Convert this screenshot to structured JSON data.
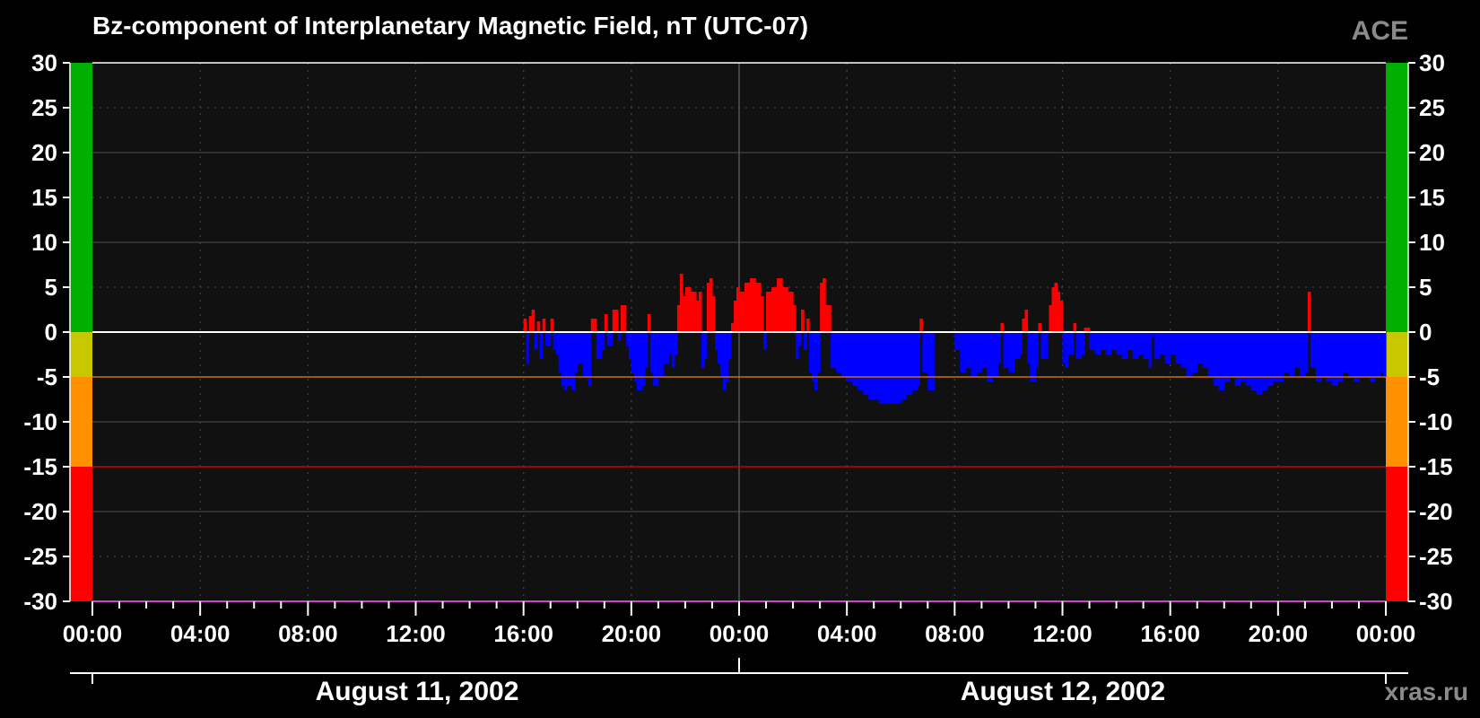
{
  "header": {
    "title": "Bz-component of Interplanetary Magnetic Field, nT (UTC-07)",
    "source": "ACE"
  },
  "footer": {
    "credit": "xras.ru",
    "dates": [
      "August 11, 2002",
      "August 12, 2002"
    ]
  },
  "colors": {
    "positive": "#ff0000",
    "negative": "#0000ff",
    "plot_bg": "#111111",
    "band_green": "#00b000",
    "band_yellow": "#c8c800",
    "band_orange": "#ff9000",
    "band_red": "#ff0000",
    "line_minus5": "#c87000",
    "line_minus15": "#c80000"
  },
  "chart_data": {
    "type": "bar",
    "title": "Bz-component of Interplanetary Magnetic Field, nT (UTC-07)",
    "xlabel": "",
    "ylabel": "",
    "xlim": [
      "2002-08-11 00:00",
      "2002-08-13 00:00"
    ],
    "ylim": [
      -30,
      30
    ],
    "yticks": [
      30,
      25,
      20,
      15,
      10,
      5,
      0,
      -5,
      -10,
      -15,
      -20,
      -25,
      -30
    ],
    "xtick_labels": [
      "00:00",
      "04:00",
      "08:00",
      "12:00",
      "16:00",
      "20:00",
      "00:00",
      "04:00",
      "08:00",
      "12:00",
      "16:00",
      "20:00",
      "00:00"
    ],
    "reference_lines": [
      0,
      -5,
      -15
    ],
    "color_bands": [
      {
        "from": 0,
        "to": 30,
        "color": "green"
      },
      {
        "from": -5,
        "to": 0,
        "color": "yellow"
      },
      {
        "from": -15,
        "to": -5,
        "color": "orange"
      },
      {
        "from": -30,
        "to": -15,
        "color": "red"
      }
    ],
    "grid": true,
    "legend": "none",
    "x_units": "hours since 2002-08-11 00:00 (UTC-07)",
    "series": [
      {
        "values": [
          [
            16.0,
            1.5
          ],
          [
            16.1,
            -3.5
          ],
          [
            16.2,
            1.8
          ],
          [
            16.3,
            2.5
          ],
          [
            16.4,
            -2.0
          ],
          [
            16.5,
            1.2
          ],
          [
            16.6,
            -3.0
          ],
          [
            16.7,
            1.5
          ],
          [
            16.8,
            -1.5
          ],
          [
            17.0,
            1.5
          ],
          [
            17.1,
            -2.0
          ],
          [
            17.2,
            -2.5
          ],
          [
            17.3,
            -4.5
          ],
          [
            17.4,
            -6.0
          ],
          [
            17.5,
            -6.5
          ],
          [
            17.6,
            -6.0
          ],
          [
            17.8,
            -6.5
          ],
          [
            17.9,
            -4.5
          ],
          [
            18.0,
            -3.5
          ],
          [
            18.2,
            -5.0
          ],
          [
            18.4,
            -6.0
          ],
          [
            18.5,
            1.5
          ],
          [
            18.7,
            -3.0
          ],
          [
            18.9,
            -2.0
          ],
          [
            19.0,
            2.0
          ],
          [
            19.1,
            -1.5
          ],
          [
            19.3,
            2.5
          ],
          [
            19.5,
            -1.0
          ],
          [
            19.6,
            3.0
          ],
          [
            19.8,
            -1.5
          ],
          [
            19.9,
            -3.0
          ],
          [
            20.0,
            -4.5
          ],
          [
            20.1,
            -5.5
          ],
          [
            20.2,
            -6.5
          ],
          [
            20.4,
            -6.0
          ],
          [
            20.5,
            -4.0
          ],
          [
            20.6,
            2.0
          ],
          [
            20.7,
            -4.5
          ],
          [
            20.8,
            -6.0
          ],
          [
            21.0,
            -5.0
          ],
          [
            21.2,
            -3.5
          ],
          [
            21.4,
            -2.5
          ],
          [
            21.5,
            -4.0
          ],
          [
            21.6,
            -2.5
          ],
          [
            21.7,
            3.0
          ],
          [
            21.8,
            6.5
          ],
          [
            21.9,
            4.0
          ],
          [
            22.0,
            5.0
          ],
          [
            22.2,
            4.5
          ],
          [
            22.4,
            3.5
          ],
          [
            22.5,
            4.5
          ],
          [
            22.6,
            -4.0
          ],
          [
            22.7,
            -3.0
          ],
          [
            22.8,
            5.5
          ],
          [
            22.9,
            6.0
          ],
          [
            23.0,
            4.0
          ],
          [
            23.1,
            -2.0
          ],
          [
            23.2,
            -3.5
          ],
          [
            23.3,
            -5.0
          ],
          [
            23.4,
            -6.5
          ],
          [
            23.5,
            -5.5
          ],
          [
            23.6,
            -3.0
          ],
          [
            23.7,
            1.0
          ],
          [
            23.8,
            3.5
          ],
          [
            23.9,
            5.0
          ],
          [
            24.0,
            4.5
          ],
          [
            24.2,
            5.5
          ],
          [
            24.4,
            6.0
          ],
          [
            24.6,
            5.5
          ],
          [
            24.8,
            4.0
          ],
          [
            24.9,
            -2.0
          ],
          [
            25.0,
            4.5
          ],
          [
            25.2,
            5.0
          ],
          [
            25.4,
            6.0
          ],
          [
            25.6,
            5.0
          ],
          [
            25.8,
            4.5
          ],
          [
            26.0,
            3.0
          ],
          [
            26.1,
            -3.0
          ],
          [
            26.2,
            -1.5
          ],
          [
            26.3,
            2.5
          ],
          [
            26.4,
            -2.0
          ],
          [
            26.5,
            1.5
          ],
          [
            26.6,
            -4.5
          ],
          [
            26.7,
            -5.5
          ],
          [
            26.8,
            -6.5
          ],
          [
            26.9,
            -4.5
          ],
          [
            27.0,
            5.5
          ],
          [
            27.1,
            6.0
          ],
          [
            27.2,
            3.0
          ],
          [
            27.4,
            -4.0
          ],
          [
            27.6,
            -4.5
          ],
          [
            27.8,
            -5.0
          ],
          [
            28.0,
            -5.5
          ],
          [
            28.2,
            -6.0
          ],
          [
            28.4,
            -6.5
          ],
          [
            28.6,
            -7.0
          ],
          [
            28.8,
            -7.5
          ],
          [
            29.0,
            -7.5
          ],
          [
            29.2,
            -8.0
          ],
          [
            29.4,
            -8.0
          ],
          [
            29.6,
            -8.0
          ],
          [
            29.8,
            -8.0
          ],
          [
            30.0,
            -7.5
          ],
          [
            30.2,
            -7.0
          ],
          [
            30.4,
            -6.5
          ],
          [
            30.6,
            -6.0
          ],
          [
            30.7,
            1.5
          ],
          [
            30.8,
            -4.5
          ],
          [
            31.0,
            -6.5
          ],
          [
            32.0,
            -2.0
          ],
          [
            32.2,
            -4.5
          ],
          [
            32.4,
            -4.0
          ],
          [
            32.6,
            -5.0
          ],
          [
            32.8,
            -4.5
          ],
          [
            33.0,
            -4.0
          ],
          [
            33.2,
            -5.5
          ],
          [
            33.4,
            -5.0
          ],
          [
            33.6,
            -3.5
          ],
          [
            33.7,
            1.0
          ],
          [
            33.8,
            -4.0
          ],
          [
            34.0,
            -4.5
          ],
          [
            34.2,
            -3.0
          ],
          [
            34.4,
            -2.5
          ],
          [
            34.5,
            1.5
          ],
          [
            34.6,
            2.5
          ],
          [
            34.7,
            -3.5
          ],
          [
            34.8,
            -5.5
          ],
          [
            35.0,
            -4.0
          ],
          [
            35.1,
            1.0
          ],
          [
            35.2,
            -3.0
          ],
          [
            35.5,
            3.0
          ],
          [
            35.6,
            5.0
          ],
          [
            35.7,
            5.5
          ],
          [
            35.8,
            4.5
          ],
          [
            35.9,
            3.5
          ],
          [
            36.0,
            -3.5
          ],
          [
            36.1,
            -4.0
          ],
          [
            36.2,
            -2.5
          ],
          [
            36.4,
            1.0
          ],
          [
            36.5,
            -3.0
          ],
          [
            36.7,
            -2.5
          ],
          [
            36.8,
            0.5
          ],
          [
            37.0,
            -2.0
          ],
          [
            37.2,
            -2.5
          ],
          [
            37.4,
            -2.0
          ],
          [
            37.6,
            -2.5
          ],
          [
            37.8,
            -2.0
          ],
          [
            38.0,
            -2.5
          ],
          [
            38.2,
            -3.0
          ],
          [
            38.4,
            -2.0
          ],
          [
            38.6,
            -3.0
          ],
          [
            38.8,
            -2.5
          ],
          [
            39.0,
            -3.0
          ],
          [
            39.2,
            -4.0
          ],
          [
            39.3,
            -0.5
          ],
          [
            39.4,
            -3.0
          ],
          [
            39.6,
            -2.5
          ],
          [
            39.8,
            -3.5
          ],
          [
            40.0,
            -2.5
          ],
          [
            40.2,
            -3.5
          ],
          [
            40.4,
            -4.0
          ],
          [
            40.6,
            -5.0
          ],
          [
            40.8,
            -4.5
          ],
          [
            41.0,
            -3.5
          ],
          [
            41.2,
            -4.0
          ],
          [
            41.4,
            -5.0
          ],
          [
            41.6,
            -6.0
          ],
          [
            41.8,
            -6.5
          ],
          [
            42.0,
            -5.5
          ],
          [
            42.2,
            -5.0
          ],
          [
            42.4,
            -6.0
          ],
          [
            42.6,
            -5.5
          ],
          [
            42.8,
            -6.0
          ],
          [
            43.0,
            -6.5
          ],
          [
            43.2,
            -7.0
          ],
          [
            43.4,
            -6.5
          ],
          [
            43.6,
            -6.0
          ],
          [
            43.8,
            -5.5
          ],
          [
            44.0,
            -5.5
          ],
          [
            44.2,
            -4.5
          ],
          [
            44.4,
            -5.0
          ],
          [
            44.6,
            -4.0
          ],
          [
            44.8,
            -5.0
          ],
          [
            45.0,
            -4.5
          ],
          [
            45.1,
            4.5
          ],
          [
            45.2,
            -4.0
          ],
          [
            45.4,
            -5.5
          ],
          [
            45.6,
            -5.0
          ],
          [
            45.8,
            -5.5
          ],
          [
            46.0,
            -6.0
          ],
          [
            46.2,
            -5.5
          ],
          [
            46.4,
            -4.5
          ],
          [
            46.6,
            -5.0
          ],
          [
            46.8,
            -5.5
          ],
          [
            47.0,
            -5.0
          ],
          [
            47.2,
            -5.0
          ],
          [
            47.4,
            -5.5
          ],
          [
            47.6,
            -5.0
          ],
          [
            47.8,
            -4.5
          ],
          [
            47.9,
            -5.0
          ]
        ]
      }
    ]
  }
}
